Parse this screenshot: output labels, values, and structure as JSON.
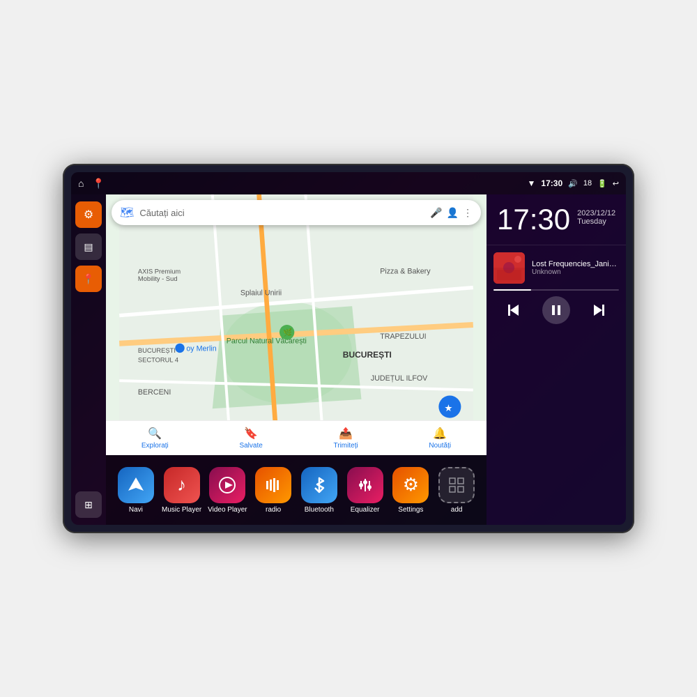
{
  "device": {
    "screen_bg": "#1a0a2e"
  },
  "status_bar": {
    "time": "17:30",
    "battery": "18",
    "left_icons": [
      "⌂",
      "📍"
    ]
  },
  "sidebar": {
    "buttons": [
      {
        "id": "settings",
        "icon": "⚙",
        "color": "orange"
      },
      {
        "id": "files",
        "icon": "≡",
        "color": "dark"
      },
      {
        "id": "maps",
        "icon": "📍",
        "color": "orange"
      }
    ],
    "grid_label": "⋮⋮⋮"
  },
  "map": {
    "search_placeholder": "Căutați aici",
    "tabs": [
      {
        "label": "Explorați",
        "icon": "🔍"
      },
      {
        "label": "Salvate",
        "icon": "🔖"
      },
      {
        "label": "Trimiteți",
        "icon": "📤"
      },
      {
        "label": "Noutăți",
        "icon": "🔔"
      }
    ],
    "locations": [
      "AXIS Premium Mobility - Sud",
      "Parcul Natural Văcărești",
      "Pizza & Bakery",
      "BUCUREȘTI SECTORUL 4",
      "BUCUREȘTI",
      "JUDEȚUL ILFOV",
      "BERCENI",
      "TRAPEZULUI"
    ]
  },
  "clock": {
    "time": "17:30",
    "date": "2023/12/12",
    "day": "Tuesday"
  },
  "music": {
    "track_name": "Lost Frequencies_Janie...",
    "artist": "Unknown",
    "progress": 30
  },
  "apps": [
    {
      "id": "navi",
      "label": "Navi",
      "color": "navi",
      "icon": "▲"
    },
    {
      "id": "music-player",
      "label": "Music Player",
      "color": "music",
      "icon": "♪"
    },
    {
      "id": "video-player",
      "label": "Video Player",
      "color": "video",
      "icon": "▶"
    },
    {
      "id": "radio",
      "label": "radio",
      "color": "radio",
      "icon": "📻"
    },
    {
      "id": "bluetooth",
      "label": "Bluetooth",
      "color": "bluetooth",
      "icon": "✦"
    },
    {
      "id": "equalizer",
      "label": "Equalizer",
      "color": "equalizer",
      "icon": "≋"
    },
    {
      "id": "settings",
      "label": "Settings",
      "color": "settings",
      "icon": "⚙"
    },
    {
      "id": "add",
      "label": "add",
      "color": "add",
      "icon": "+"
    }
  ]
}
